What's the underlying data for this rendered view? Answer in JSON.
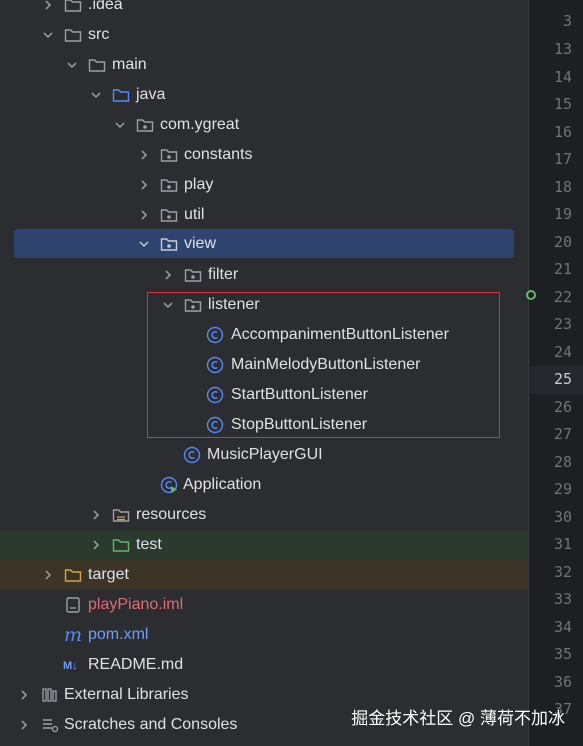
{
  "tree": {
    "items": [
      {
        "label": ".idea"
      },
      {
        "label": "src"
      },
      {
        "label": "main"
      },
      {
        "label": "java"
      },
      {
        "label": "com.ygreat"
      },
      {
        "label": "constants"
      },
      {
        "label": "play"
      },
      {
        "label": "util"
      },
      {
        "label": "view"
      },
      {
        "label": "filter"
      },
      {
        "label": "listener"
      },
      {
        "label": "AccompanimentButtonListener"
      },
      {
        "label": "MainMelodyButtonListener"
      },
      {
        "label": "StartButtonListener"
      },
      {
        "label": "StopButtonListener"
      },
      {
        "label": "MusicPlayerGUI"
      },
      {
        "label": "Application"
      },
      {
        "label": "resources"
      },
      {
        "label": "test"
      },
      {
        "label": "target"
      },
      {
        "label": "playPiano.iml"
      },
      {
        "label": "pom.xml"
      },
      {
        "label": "README.md"
      },
      {
        "label": "External Libraries"
      },
      {
        "label": "Scratches and Consoles"
      }
    ]
  },
  "gutter": {
    "line_numbers": [
      "3",
      "13",
      "14",
      "15",
      "16",
      "17",
      "18",
      "19",
      "20",
      "21",
      "22",
      "23",
      "24",
      "25",
      "26",
      "27",
      "28",
      "29",
      "30",
      "31",
      "32",
      "33",
      "34",
      "35",
      "36",
      "37"
    ],
    "active_line": "25"
  },
  "colors": {
    "selection": "#2e436e",
    "highlight_box": "#e0323c",
    "class_icon": "#548af7",
    "excluded_label": "#e06c75",
    "maven_label": "#6f9ef8"
  },
  "watermark": "掘金技术社区 @ 薄荷不加冰"
}
